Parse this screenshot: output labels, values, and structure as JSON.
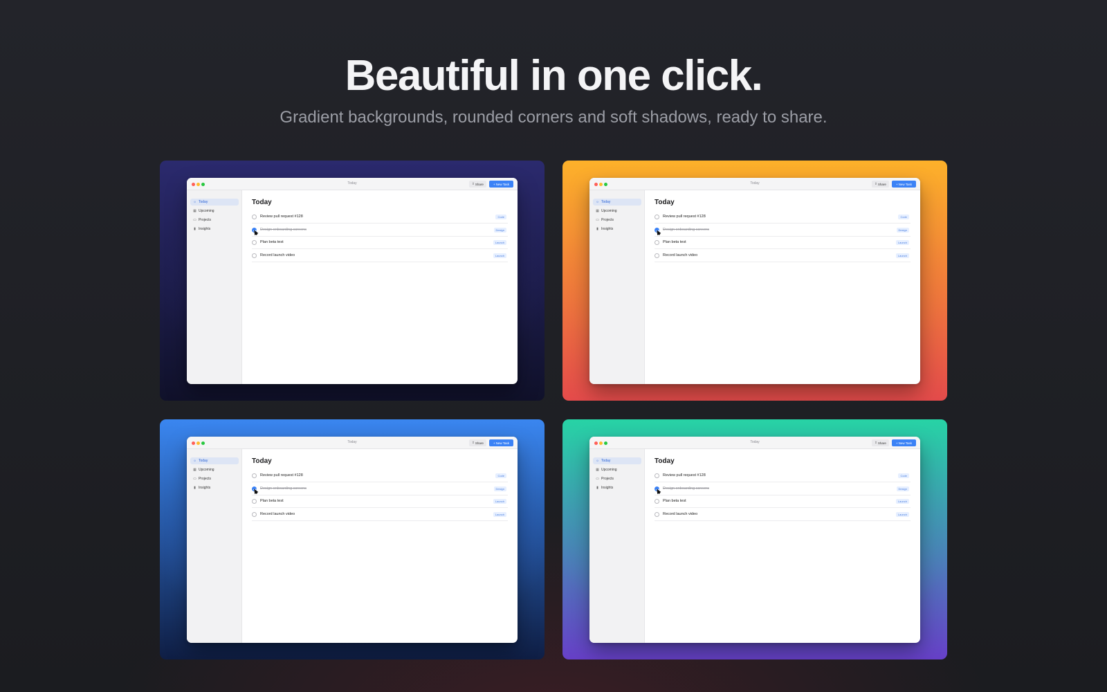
{
  "hero": {
    "title": "Beautiful in one click.",
    "subtitle": "Gradient backgrounds, rounded corners and soft shadows, ready to share."
  },
  "cards": [
    {
      "background": [
        "#2b2a6e",
        "#10112a"
      ],
      "accent": "#27276a"
    },
    {
      "background": [
        "#fdb12a",
        "#e44b4b"
      ],
      "accent": "#f57d35"
    },
    {
      "background": [
        "#3a86f0",
        "#0f1e44"
      ],
      "accent": "#2a62c4"
    },
    {
      "background": [
        "#27d3a5",
        "#6740c8"
      ],
      "accent": "#3fa6b5"
    }
  ],
  "window": {
    "title": "Today",
    "share_label": "Share",
    "share_icon": "share-icon",
    "new_task_label": "New Task",
    "new_task_icon": "plus-icon",
    "sidebar": [
      {
        "label": "Today",
        "icon": "sun-icon",
        "active": true
      },
      {
        "label": "Upcoming",
        "icon": "calendar-icon",
        "active": false
      },
      {
        "label": "Projects",
        "icon": "folder-icon",
        "active": false
      },
      {
        "label": "Insights",
        "icon": "chart-icon",
        "active": false
      }
    ],
    "heading": "Today",
    "tasks": [
      {
        "title": "Review pull request #128",
        "tag": "Code",
        "done": false
      },
      {
        "title": "Design onboarding screens",
        "tag": "Design",
        "done": true
      },
      {
        "title": "Plan beta test",
        "tag": "Launch",
        "done": false
      },
      {
        "title": "Record launch video",
        "tag": "Launch",
        "done": false
      }
    ]
  },
  "colors": {
    "primary": "#3b82f6",
    "page_bg": "#1e1f23"
  }
}
